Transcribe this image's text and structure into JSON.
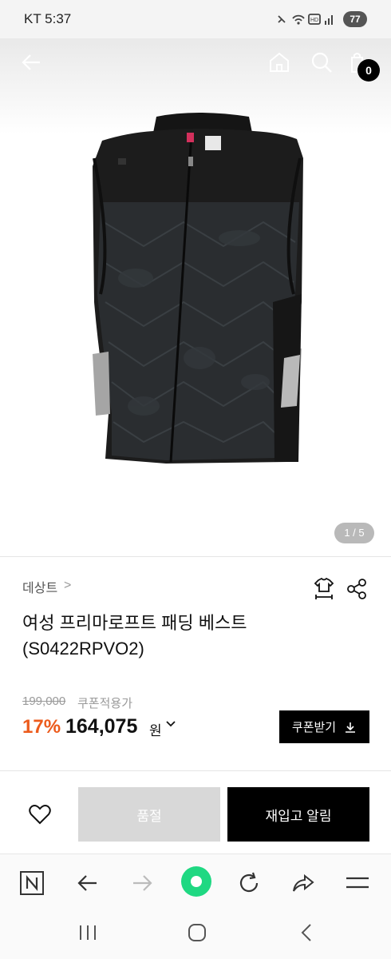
{
  "status_bar": {
    "carrier_time": "KT 5:37",
    "battery": "77"
  },
  "header": {
    "cart_count": "0",
    "icons": [
      "back-arrow-icon",
      "home-icon",
      "search-icon",
      "shopping-bag-icon"
    ]
  },
  "gallery": {
    "counter": "1 / 5"
  },
  "product": {
    "brand": "데상트",
    "brand_chevron": ">",
    "title_line1": "여성 프리마로프트 패딩 베스트",
    "title_line2": "(S0422RPVO2)",
    "original_price": "199,000",
    "coupon_price_label": "쿠폰적용가",
    "discount_rate": "17%",
    "price": "164,075",
    "currency": "원",
    "coupon_button": "쿠폰받기"
  },
  "actions": {
    "sold_out": "품절",
    "restock_alert": "재입고 알림"
  },
  "colors": {
    "accent_discount": "#ec5b1c",
    "primary_button": "#000000",
    "disabled_button": "#d8d8d8",
    "browser_green": "#1fd882"
  }
}
